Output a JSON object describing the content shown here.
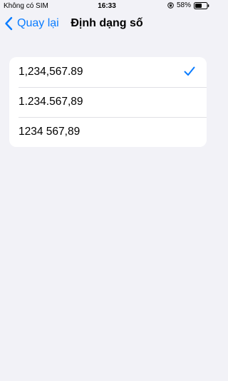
{
  "status_bar": {
    "carrier": "Không có SIM",
    "time": "16:33",
    "battery_percent": "58%",
    "battery_level": 0.58
  },
  "nav": {
    "back_label": "Quay lại",
    "title": "Định dạng số"
  },
  "options": [
    {
      "label": "1,234,567.89",
      "selected": true
    },
    {
      "label": "1.234.567,89",
      "selected": false
    },
    {
      "label": "1234 567,89",
      "selected": false
    }
  ],
  "colors": {
    "accent": "#0a7cff",
    "background": "#f2f2f7"
  },
  "icons": {
    "back": "chevron-left-icon",
    "checkmark": "checkmark-icon",
    "lock": "orientation-lock-icon",
    "battery": "battery-icon"
  }
}
